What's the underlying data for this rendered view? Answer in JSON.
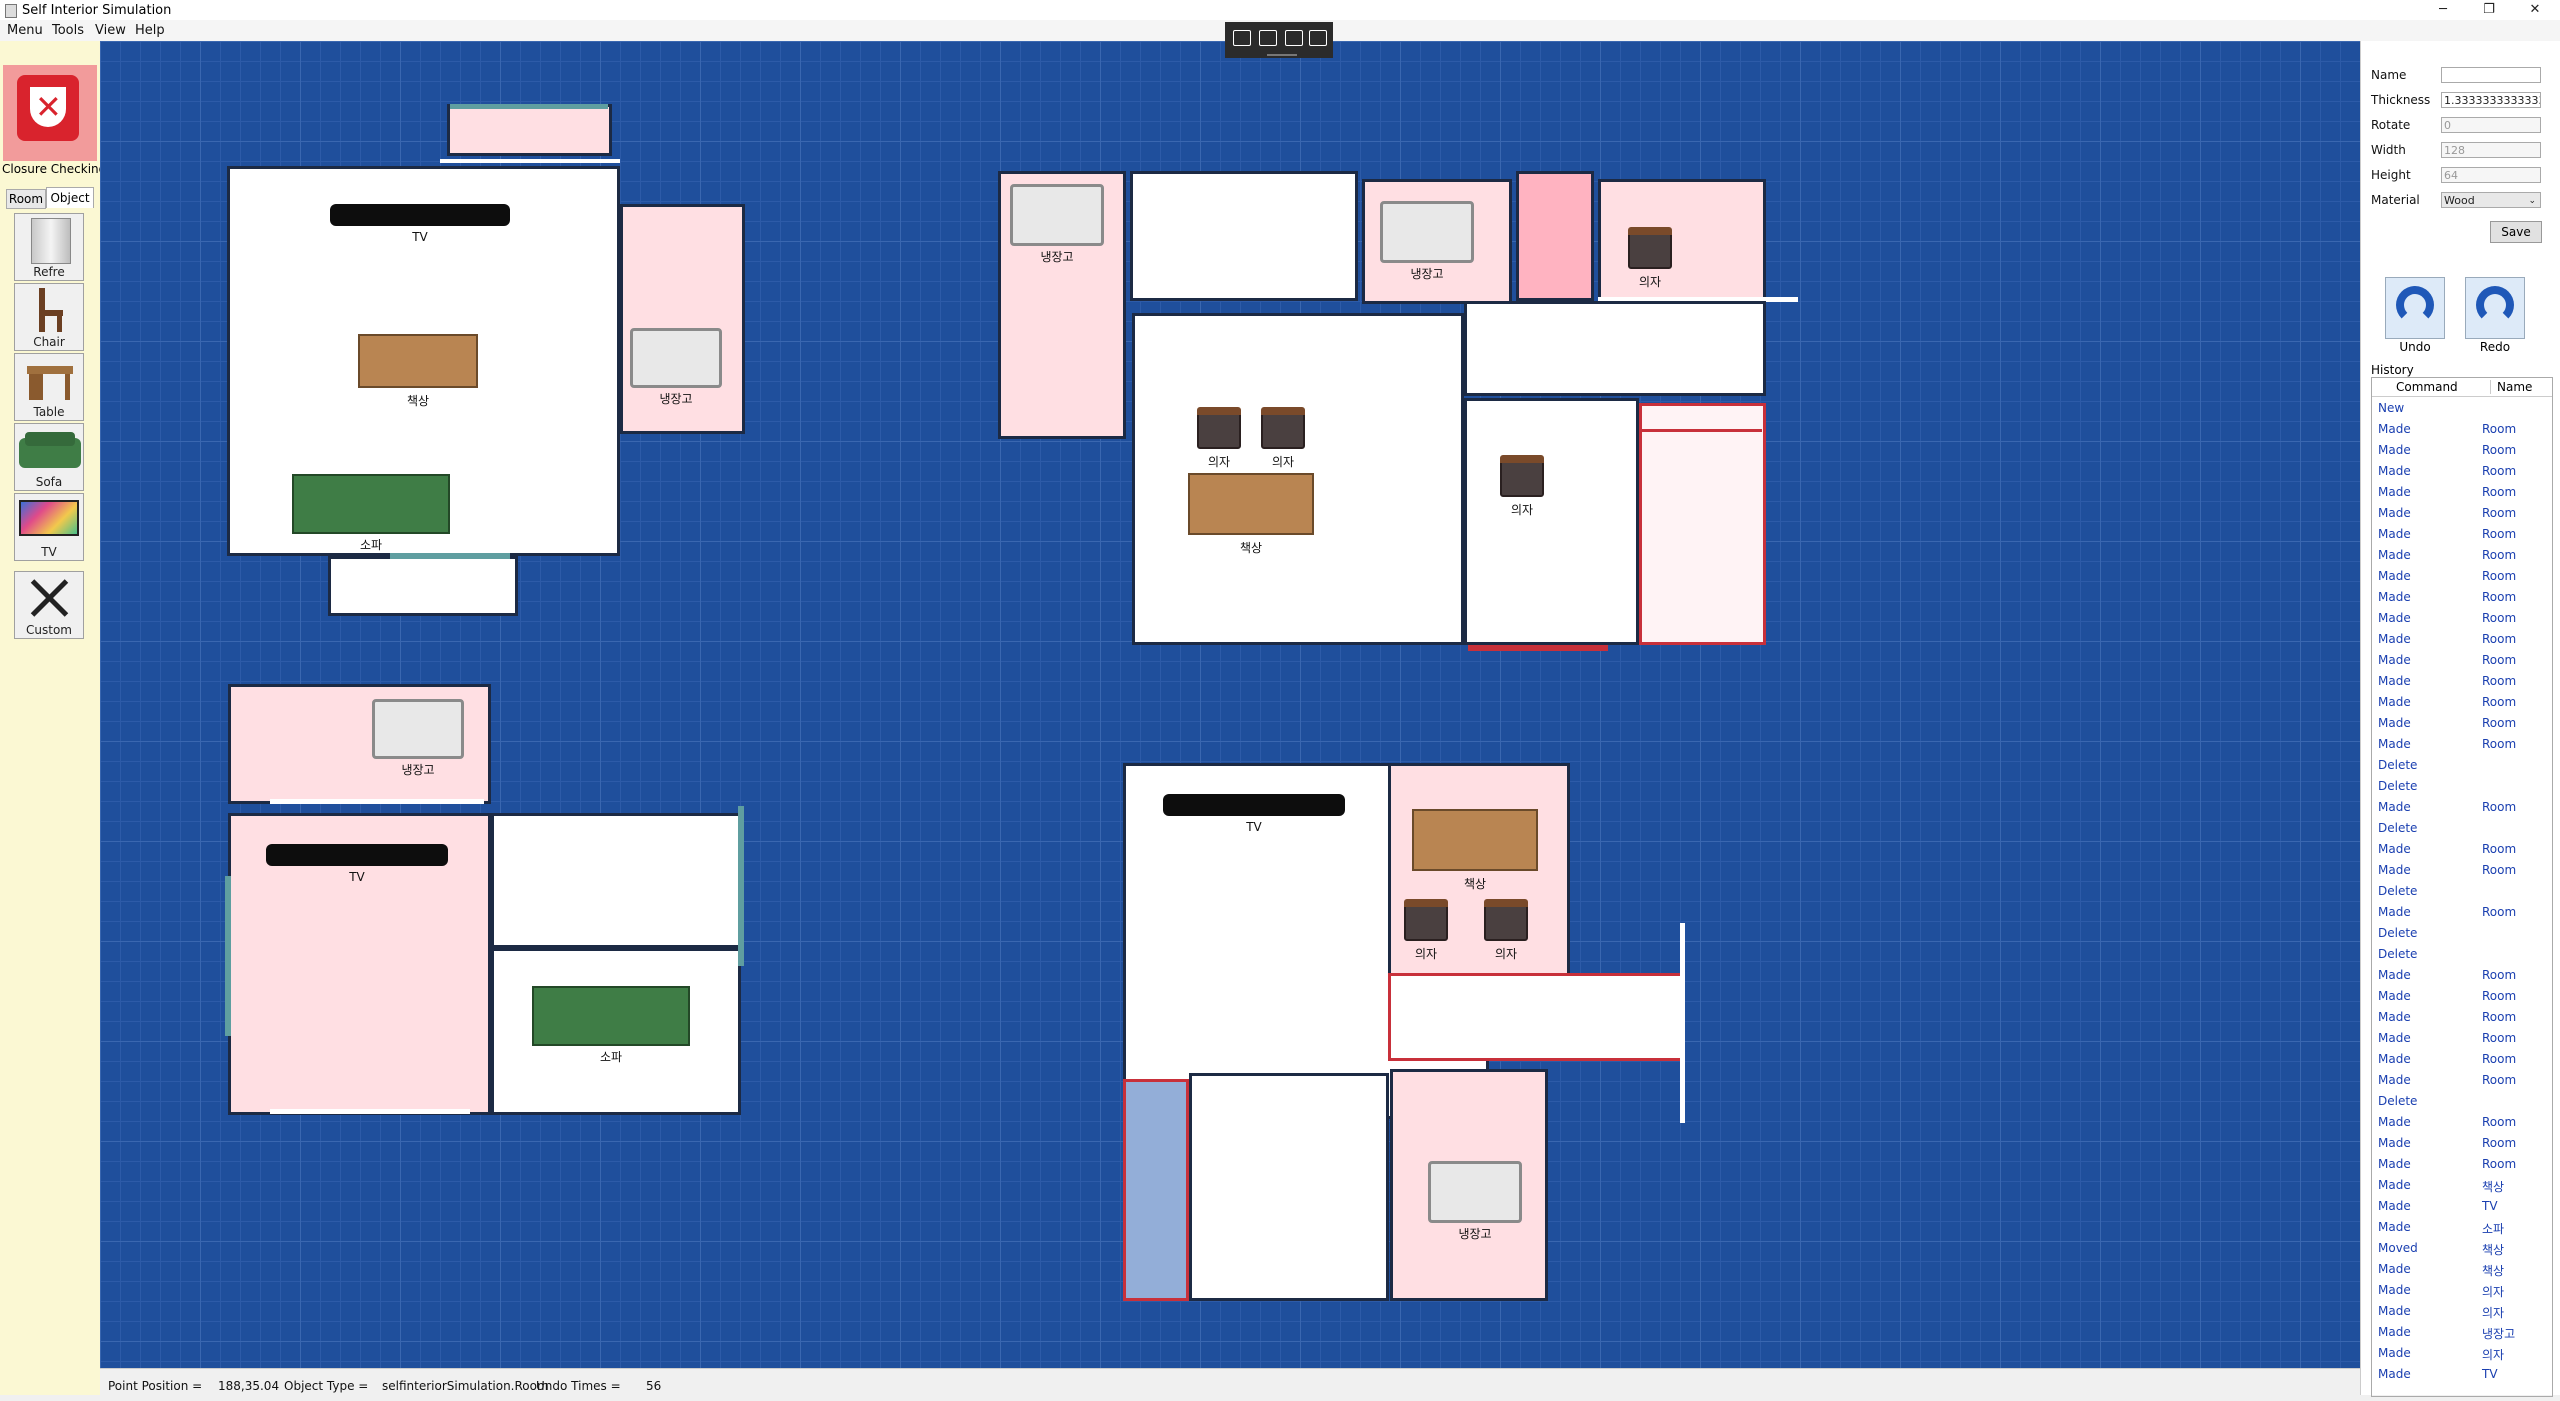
{
  "window": {
    "title": "Self Interior Simulation",
    "minimize": "─",
    "maximize": "❐",
    "close": "✕"
  },
  "menu": [
    "Menu",
    "Tools",
    "View",
    "Help"
  ],
  "left_panel": {
    "closure_label": "Closure Checking",
    "tabs": [
      "Room",
      "Object"
    ],
    "objects": [
      "Refre",
      "Chair",
      "Table",
      "Sofa",
      "TV",
      "Custom"
    ]
  },
  "furniture_labels": {
    "tv": "TV",
    "desk": "책상",
    "sofa": "소파",
    "fridge": "냉장고",
    "chair": "의자"
  },
  "properties": {
    "name_label": "Name",
    "name_value": "",
    "thickness_label": "Thickness",
    "thickness_value": "1.3333333333333",
    "rotate_label": "Rotate",
    "rotate_value": "0",
    "width_label": "Width",
    "width_value": "128",
    "height_label": "Height",
    "height_value": "64",
    "material_label": "Material",
    "material_value": "Wood",
    "save": "Save"
  },
  "undo_label": "Undo",
  "redo_label": "Redo",
  "history": {
    "label": "History",
    "col_command": "Command",
    "col_name": "Name",
    "rows": [
      [
        "New",
        ""
      ],
      [
        "Made",
        "Room"
      ],
      [
        "Made",
        "Room"
      ],
      [
        "Made",
        "Room"
      ],
      [
        "Made",
        "Room"
      ],
      [
        "Made",
        "Room"
      ],
      [
        "Made",
        "Room"
      ],
      [
        "Made",
        "Room"
      ],
      [
        "Made",
        "Room"
      ],
      [
        "Made",
        "Room"
      ],
      [
        "Made",
        "Room"
      ],
      [
        "Made",
        "Room"
      ],
      [
        "Made",
        "Room"
      ],
      [
        "Made",
        "Room"
      ],
      [
        "Made",
        "Room"
      ],
      [
        "Made",
        "Room"
      ],
      [
        "Made",
        "Room"
      ],
      [
        "Delete",
        ""
      ],
      [
        "Delete",
        ""
      ],
      [
        "Made",
        "Room"
      ],
      [
        "Delete",
        ""
      ],
      [
        "Made",
        "Room"
      ],
      [
        "Made",
        "Room"
      ],
      [
        "Delete",
        ""
      ],
      [
        "Made",
        "Room"
      ],
      [
        "Delete",
        ""
      ],
      [
        "Delete",
        ""
      ],
      [
        "Made",
        "Room"
      ],
      [
        "Made",
        "Room"
      ],
      [
        "Made",
        "Room"
      ],
      [
        "Made",
        "Room"
      ],
      [
        "Made",
        "Room"
      ],
      [
        "Made",
        "Room"
      ],
      [
        "Delete",
        ""
      ],
      [
        "Made",
        "Room"
      ],
      [
        "Made",
        "Room"
      ],
      [
        "Made",
        "Room"
      ],
      [
        "Made",
        "책상"
      ],
      [
        "Made",
        "TV"
      ],
      [
        "Made",
        "소파"
      ],
      [
        "Moved",
        "책상"
      ],
      [
        "Made",
        "책상"
      ],
      [
        "Made",
        "의자"
      ],
      [
        "Made",
        "의자"
      ],
      [
        "Made",
        "냉장고"
      ],
      [
        "Made",
        "의자"
      ],
      [
        "Made",
        "TV"
      ]
    ]
  },
  "status": {
    "point_label": "Point Position =",
    "point_value": "188,35.04",
    "type_label": "Object Type =",
    "type_value": "selfinteriorSimulation.Room",
    "undo_label": "Undo Times =",
    "undo_value": "56"
  }
}
